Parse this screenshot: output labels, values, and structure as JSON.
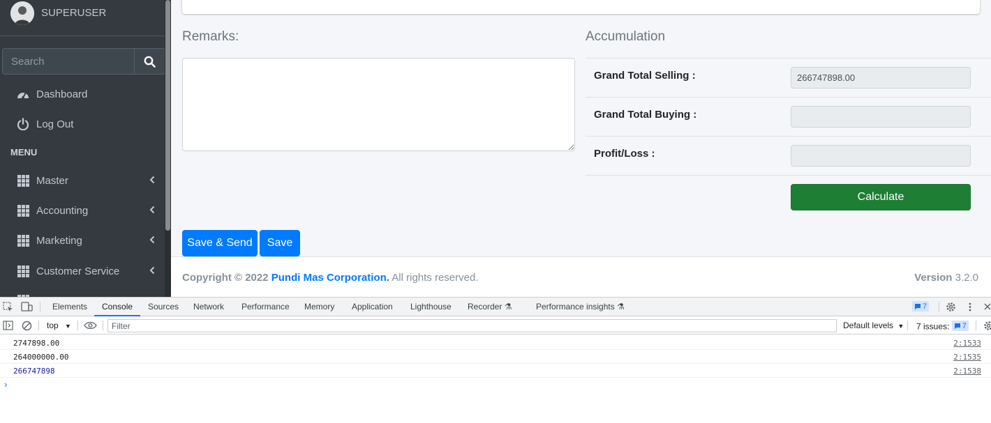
{
  "sidebar": {
    "user_name": "SUPERUSER",
    "search_placeholder": "Search",
    "items": [
      {
        "label": "Dashboard",
        "icon": "tachometer-icon"
      },
      {
        "label": "Log Out",
        "icon": "power-icon"
      }
    ],
    "menu_header": "MENU",
    "menu_items": [
      {
        "label": "Master",
        "icon": "th-icon"
      },
      {
        "label": "Accounting",
        "icon": "th-icon"
      },
      {
        "label": "Marketing",
        "icon": "th-icon"
      },
      {
        "label": "Customer Service",
        "icon": "th-icon"
      }
    ]
  },
  "main": {
    "remarks_label": "Remarks:",
    "accumulation_title": "Accumulation",
    "rows": [
      {
        "label": "Grand Total Selling :",
        "value": "266747898.00"
      },
      {
        "label": "Grand Total Buying :",
        "value": ""
      },
      {
        "label": "Profit/Loss :",
        "value": ""
      }
    ],
    "calculate_label": "Calculate",
    "save_send_label": "Save & Send",
    "save_label": "Save"
  },
  "footer": {
    "copyright_prefix": "Copyright © 2022",
    "company": "Pundi Mas Corporation.",
    "rights": "All rights reserved.",
    "version_label": "Version",
    "version": "3.2.0"
  },
  "devtools": {
    "tabs": [
      "Elements",
      "Console",
      "Sources",
      "Network",
      "Performance",
      "Memory",
      "Application",
      "Lighthouse",
      "Recorder",
      "Performance insights"
    ],
    "active_tab": "Console",
    "issue_count_top": "7",
    "context": "top",
    "filter_placeholder": "Filter",
    "levels": "Default levels",
    "issues_label": "7 issues:",
    "issues_count": "7",
    "logs": [
      {
        "text": "2747898.00",
        "source": "2:1533",
        "numeric": false
      },
      {
        "text": "264000000.00",
        "source": "2:1535",
        "numeric": false
      },
      {
        "text": "266747898",
        "source": "2:1538",
        "numeric": true
      }
    ],
    "prompt": "›"
  }
}
